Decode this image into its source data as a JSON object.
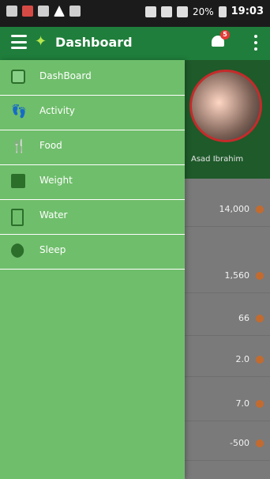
{
  "status_bar": {
    "time": "19:03",
    "battery": "20%"
  },
  "app_bar": {
    "title": "Dashboard",
    "notification_count": "5"
  },
  "drawer": {
    "items": [
      {
        "label": "DashBoard",
        "icon": "dashboard-icon"
      },
      {
        "label": "Activity",
        "icon": "footprints-icon"
      },
      {
        "label": "Food",
        "icon": "utensils-icon"
      },
      {
        "label": "Weight",
        "icon": "scale-icon"
      },
      {
        "label": "Water",
        "icon": "water-glass-icon"
      },
      {
        "label": "Sleep",
        "icon": "moon-icon"
      }
    ]
  },
  "profile": {
    "name": "Asad Ibrahim"
  },
  "metrics": {
    "values": [
      "14,000",
      "1,560",
      "66",
      "2.0",
      "7.0",
      "-500"
    ]
  },
  "colors": {
    "app_bar": "#1f7e3b",
    "drawer_bg": "#6fbe6b",
    "accent": "#c36b2f"
  }
}
